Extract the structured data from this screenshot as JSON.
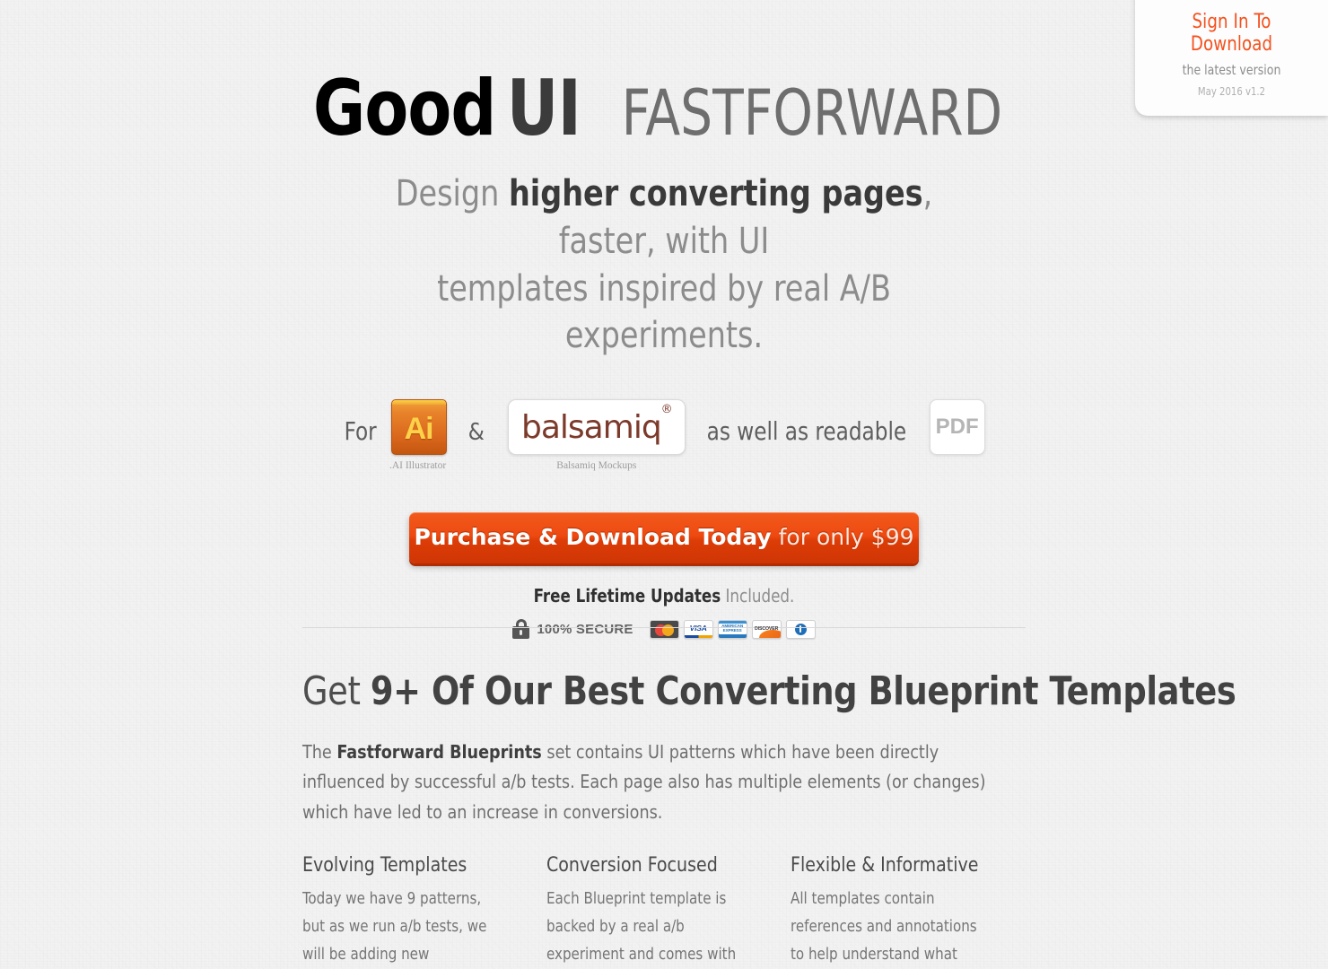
{
  "signin": {
    "link_label": "Sign In To Download",
    "subtitle": "the latest version",
    "version": "May 2016 v1.2",
    "accent_color": "#f4511e"
  },
  "hero": {
    "logo_good": "Good",
    "logo_ui": "UI",
    "logo_fastforward": "FASTFORWARD",
    "subhead_line1_pre": "Design ",
    "subhead_line1_bold": "higher converting pages",
    "subhead_line1_post": ", faster, with UI",
    "subhead_line2": "templates inspired by real A/B experiments."
  },
  "formats": {
    "prefix_label": "For",
    "ampersand": "&",
    "illustrator": {
      "tile_text": "Ai",
      "caption": ".AI Illustrator"
    },
    "balsamiq": {
      "tile_text": "balsamiq",
      "registered_mark": "®",
      "caption": "Balsamiq Mockups"
    },
    "middle_label": "as well as readable",
    "pdf": {
      "tile_text": "PDF"
    }
  },
  "cta": {
    "strong_label": "Purchase & Download Today",
    "rest_label": " for only $99"
  },
  "assurance": {
    "updates_bold": "Free Lifetime Updates",
    "updates_rest": " Included.",
    "secure_label": "100% SECURE",
    "lock_icon": "lock-icon",
    "cards": [
      {
        "name": "mastercard",
        "label": ""
      },
      {
        "name": "visa",
        "label": "VISA"
      },
      {
        "name": "american-express",
        "label": "AMERICAN EXPRESS"
      },
      {
        "name": "discover",
        "label": "DISCOVER"
      },
      {
        "name": "diners-club",
        "label": ""
      }
    ]
  },
  "lower": {
    "heading_light": "Get ",
    "heading_bold": "9+ Of Our Best Converting Blueprint Templates",
    "body_pre": "The ",
    "body_bold": "Fastforward Blueprints",
    "body_post": " set contains UI patterns which have been directly influenced by successful a/b tests. Each page also has multiple elements (or changes) which have led to an increase in conversions.",
    "columns": [
      {
        "heading": "Evolving Templates",
        "body": "Today we have 9 patterns, but as we run a/b tests, we will be adding new"
      },
      {
        "heading": "Conversion Focused",
        "body": "Each Blueprint template is backed by a real a/b experiment and comes with"
      },
      {
        "heading": "Flexible & Informative",
        "body": "All templates contain references and annotations to help understand what"
      }
    ]
  }
}
